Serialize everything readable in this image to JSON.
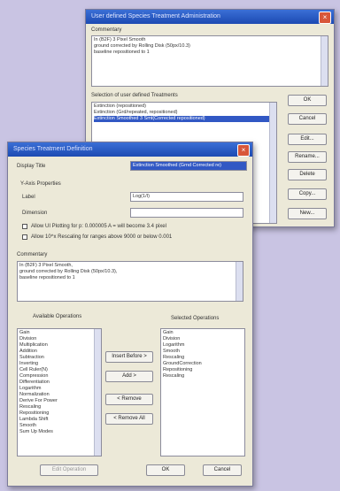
{
  "admin": {
    "title": "User defined Species Treatment Administration",
    "comment_label": "Commentary",
    "comment_lines": [
      "In (B2F) 3 Pixel Smooth",
      "ground corrected by Rolling Disk (50px/10.3)",
      "baseline repositioned to 1"
    ],
    "list_label": "Selection of user defined Treatments",
    "treatments": [
      "Extinction (repositioned)",
      "Extinction (Grd/repeated, repositioned)",
      "Extinction Smoothed 3 Smt(Corrected repositioned)"
    ],
    "selected_index": 2,
    "buttons": [
      "OK",
      "Cancel",
      "Edit...",
      "Rename...",
      "Delete",
      "Copy...",
      "New..."
    ]
  },
  "def": {
    "title": "Species Treatment Definition",
    "display_title_label": "Display Title",
    "display_title_value": "Extinction Smoothed (Grnd Corrected re)",
    "axis_group_label": "Y-Axis Properties",
    "label_label": "Label",
    "label_value": "Log(1/I)",
    "dimension_label": "Dimension",
    "dimension_value": "",
    "check1": "Allow UI Plotting for p: 0.000005 A = will become 3.4 pixel",
    "check2": "Allow 10^x Rescaling for ranges above 9000 or below 0.001",
    "comment_label": "Commentary",
    "comment_lines": [
      "In (B2F) 3 Pixel Smooth,",
      "ground corrected by Rolling Disk (50px/10.3),",
      "baseline repositioned to 1"
    ],
    "available_label": "Available Operations",
    "available": [
      "Gain",
      "Division",
      "Multiplication",
      "Addition",
      "Subtraction",
      "Inverting",
      "Cell Ruler(N)",
      "Compression",
      "Differentiation",
      "Logarithm",
      "Normalization",
      "Derive For Power",
      "Rescaling",
      "Repositioning",
      "Lambda Shift",
      "Smooth",
      "Sum Up Modes"
    ],
    "selected_label": "Selected Operations",
    "selected": [
      "Gain",
      "Division",
      "Logarithm",
      "Smooth",
      "Rescaling",
      "GroundCorrection",
      "Repositioning",
      "Rescaling"
    ],
    "btn_insert": "Insert Before >",
    "btn_add": "Add >",
    "btn_remove": "< Remove",
    "btn_remove_all": "< Remove All",
    "btn_bottom": "Edit Operation",
    "btn_ok": "OK",
    "btn_cancel": "Cancel"
  }
}
